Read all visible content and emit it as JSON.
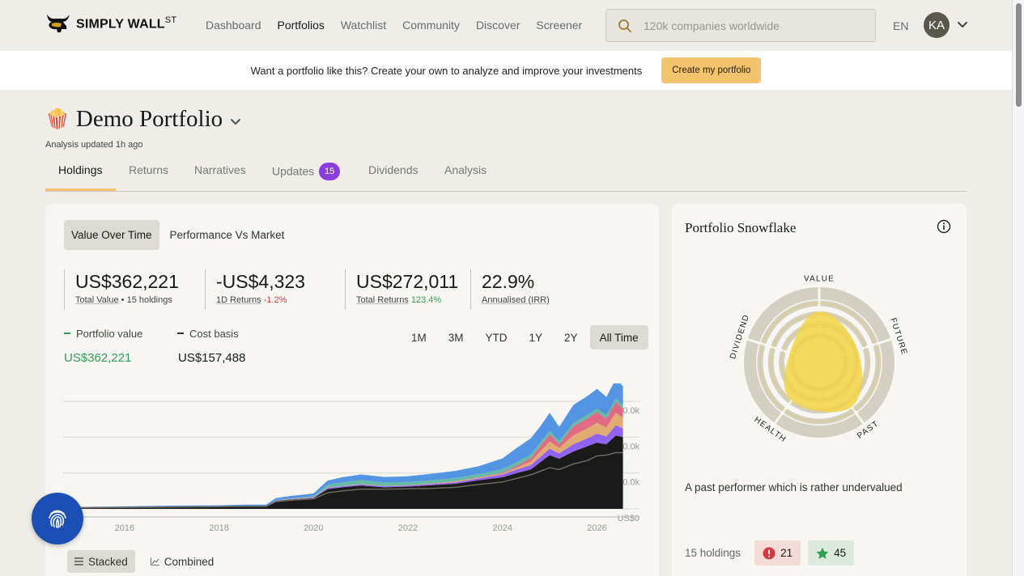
{
  "brand": {
    "name": "SIMPLY WALL",
    "suffix": "ST"
  },
  "nav": {
    "items": [
      "Dashboard",
      "Portfolios",
      "Watchlist",
      "Community",
      "Discover",
      "Screener"
    ],
    "active": "Portfolios"
  },
  "search": {
    "placeholder": "120k companies worldwide"
  },
  "lang": "EN",
  "user": {
    "initials": "KA"
  },
  "banner": {
    "text": "Want a portfolio like this? Create your own to analyze and improve your investments",
    "button": "Create my portfolio"
  },
  "portfolio": {
    "emoji": "🍿",
    "title": "Demo Portfolio",
    "updated": "Analysis updated 1h ago"
  },
  "tabs": [
    {
      "label": "Holdings"
    },
    {
      "label": "Returns"
    },
    {
      "label": "Narratives"
    },
    {
      "label": "Updates",
      "badge": "15"
    },
    {
      "label": "Dividends"
    },
    {
      "label": "Analysis"
    }
  ],
  "view_toggle": [
    "Value Over Time",
    "Performance Vs Market"
  ],
  "stats": [
    {
      "value": "US$362,221",
      "label": "Total Value",
      "extra": "• 15 holdings"
    },
    {
      "value": "-US$4,323",
      "label": "1D Returns",
      "change": "-1.2%"
    },
    {
      "value": "US$272,011",
      "label": "Total Returns",
      "change": "123.4%"
    },
    {
      "value": "22.9%",
      "label": "Annualised (IRR)"
    }
  ],
  "legend": [
    {
      "name": "Portfolio value",
      "value": "US$362,221",
      "color": "#2e9e57"
    },
    {
      "name": "Cost basis",
      "value": "US$157,488",
      "color": "#333333"
    }
  ],
  "ranges": [
    "1M",
    "3M",
    "YTD",
    "1Y",
    "2Y",
    "All Time"
  ],
  "range_active": "All Time",
  "chart_toggle": [
    "Stacked",
    "Combined"
  ],
  "chart_data": {
    "type": "area",
    "x": [
      2014.7,
      2015,
      2016,
      2017,
      2018,
      2018.6,
      2019,
      2019.2,
      2019.5,
      2020,
      2020.3,
      2020.6,
      2021,
      2021.5,
      2022,
      2022.5,
      2023,
      2023.5,
      2024,
      2024.3,
      2024.6,
      2024.8,
      2025,
      2025.2,
      2025.5,
      2025.8,
      2026,
      2026.2,
      2026.4,
      2026.55
    ],
    "series": [
      {
        "color": "#1a1a1a",
        "values": [
          2,
          3,
          4,
          5,
          6,
          7,
          7,
          22,
          26,
          30,
          55,
          60,
          65,
          60,
          62,
          66,
          70,
          80,
          88,
          100,
          110,
          130,
          150,
          140,
          160,
          175,
          185,
          180,
          205,
          200
        ]
      },
      {
        "color": "#8a5cf0",
        "values": [
          0,
          0,
          0,
          0,
          0,
          0,
          0,
          1,
          1,
          2,
          3,
          3,
          3,
          3,
          3,
          3,
          4,
          5,
          8,
          10,
          12,
          15,
          18,
          15,
          20,
          22,
          25,
          22,
          28,
          25
        ]
      },
      {
        "color": "#e0a76a",
        "values": [
          0,
          0,
          0,
          0,
          0,
          0,
          0,
          0,
          1,
          1,
          1,
          1,
          1,
          1,
          1,
          1,
          2,
          2,
          3,
          5,
          10,
          15,
          20,
          15,
          25,
          28,
          30,
          25,
          35,
          30
        ]
      },
      {
        "color": "#e0627e",
        "values": [
          0,
          0,
          0,
          0,
          0,
          0,
          0,
          0,
          0,
          0,
          0,
          0,
          0,
          0,
          0,
          1,
          1,
          1,
          2,
          5,
          10,
          15,
          20,
          10,
          25,
          28,
          30,
          25,
          30,
          25
        ]
      },
      {
        "color": "#5fb6a2",
        "values": [
          0,
          0,
          0,
          0,
          0,
          0,
          0,
          1,
          1,
          2,
          8,
          10,
          11,
          10,
          9,
          9,
          9,
          9,
          10,
          10,
          10,
          10,
          10,
          9,
          10,
          10,
          10,
          10,
          10,
          10
        ]
      },
      {
        "color": "#4a8fe0",
        "values": [
          1,
          2,
          3,
          4,
          4,
          5,
          5,
          6,
          7,
          8,
          12,
          14,
          16,
          15,
          16,
          18,
          20,
          22,
          30,
          40,
          45,
          45,
          50,
          40,
          50,
          52,
          55,
          50,
          55,
          52
        ]
      }
    ],
    "cost_basis": [
      2,
      3,
      4,
      5,
      6,
      7,
      7,
      20,
      24,
      28,
      45,
      50,
      55,
      55,
      56,
      57,
      60,
      68,
      75,
      85,
      95,
      105,
      115,
      110,
      125,
      135,
      148,
      150,
      157,
      157
    ],
    "xlim": [
      2014.7,
      2026.9
    ],
    "ylim": [
      0,
      350
    ],
    "xticks": [
      "2016",
      "2018",
      "2020",
      "2022",
      "2024",
      "2026"
    ],
    "yticks": [
      "US$0",
      "US$100.0k",
      "US$200.0k",
      "US$300.0k"
    ]
  },
  "snowflake": {
    "title": "Portfolio Snowflake",
    "axes": [
      "VALUE",
      "FUTURE",
      "PAST",
      "HEALTH",
      "DIVIDEND"
    ],
    "scores": {
      "value": 4.5,
      "future": 3.2,
      "past": 5,
      "health": 4,
      "dividend": 2
    },
    "color": "#f2d654",
    "description": "A past performer which is rather undervalued",
    "holdings": "15 holdings",
    "warnings": "21",
    "rewards": "45"
  }
}
